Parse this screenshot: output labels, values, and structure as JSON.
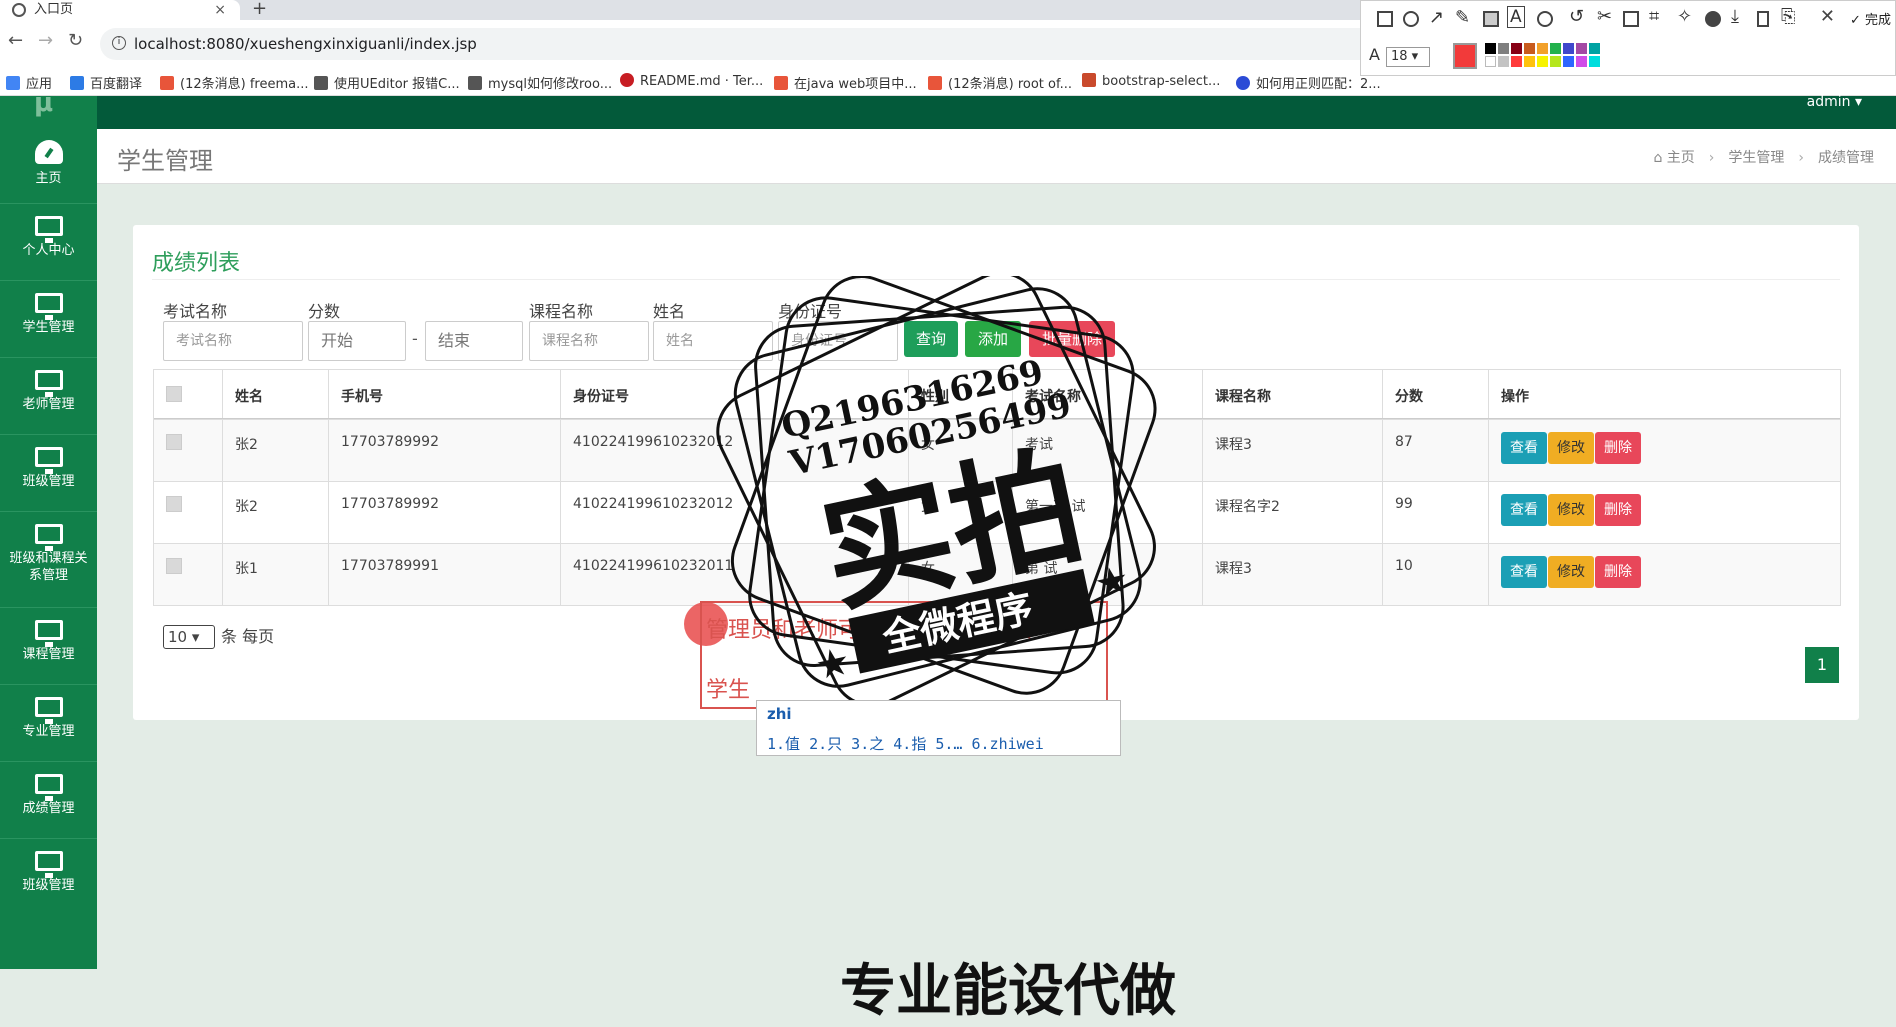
{
  "browser": {
    "tab_title": "入口页",
    "new_tab": "+",
    "close_tab": "×",
    "url": "localhost:8080/xueshengxinxiguanli/index.jsp",
    "bookmarks": [
      "应用",
      "百度翻译",
      "(12条消息) freema...",
      "使用UEditor 报错C...",
      "mysql如何修改roo...",
      "README.md · Ter...",
      "在java web项目中...",
      "(12条消息) root of...",
      "bootstrap-select...",
      "如何用正则匹配：2..."
    ]
  },
  "app": {
    "admin_label": "admin ▾",
    "sidebar": [
      "主页",
      "个人中心",
      "学生管理",
      "老师管理",
      "班级管理",
      "班级和课程关系管理",
      "课程管理",
      "专业管理",
      "成绩管理",
      "班级管理"
    ],
    "page_title": "学生管理",
    "breadcrumb": [
      "主页",
      "学生管理",
      "成绩管理"
    ]
  },
  "panel": {
    "title": "成绩列表",
    "filters": {
      "exam_label": "考试名称",
      "exam_placeholder": "考试名称",
      "score_label": "分数",
      "score_start": "开始",
      "score_end": "结束",
      "score_dash": "-",
      "course_label": "课程名称",
      "course_placeholder": "课程名称",
      "name_label": "姓名",
      "name_placeholder": "姓名",
      "id_label": "身份证号",
      "id_placeholder": "身份证号"
    },
    "buttons": {
      "query": "查询",
      "add": "添加",
      "batch_delete": "批量删除"
    },
    "columns": [
      "姓名",
      "手机号",
      "身份证号",
      "性别",
      "考试名称",
      "课程名称",
      "分数",
      "操作"
    ],
    "rows": [
      {
        "name": "张2",
        "phone": "17703789992",
        "idno": "410224199610232012",
        "gender": "女",
        "exam": "考试",
        "course": "课程3",
        "score": "87"
      },
      {
        "name": "张2",
        "phone": "17703789992",
        "idno": "410224199610232012",
        "gender": "女",
        "exam": "第一次 试",
        "course": "课程名字2",
        "score": "99"
      },
      {
        "name": "张1",
        "phone": "17703789991",
        "idno": "410224199610232011",
        "gender": "女",
        "exam": "第 试",
        "course": "课程3",
        "score": "10"
      }
    ],
    "row_actions": {
      "view": "查看",
      "edit": "修改",
      "delete": "删除"
    },
    "page_size": "10",
    "page_size_suffix": "条 每页",
    "current_page": "1"
  },
  "overlay": {
    "stamp_line1": "Q2196316269",
    "stamp_line2": "V17060256499",
    "stamp_big": "实拍",
    "stamp_banner": "全微程序",
    "note_line1": "管理员和老师可",
    "note_line1_tail": "页",
    "note_line2": "学生",
    "ime_code": "zhi",
    "ime_candidates": "1.值  2.只  3.之  4.指  5.…  6.zhiwei",
    "bottom_text": "专业能设代做"
  },
  "annotation_toolbar": {
    "font_size": "18",
    "font_size_label": "A",
    "done": "✓ 完成",
    "close": "✕",
    "current_color": "#f23a3a",
    "palette": [
      "#000000",
      "#7f7f7f",
      "#880015",
      "#c85b1e",
      "#f2a12b",
      "#22b14c",
      "#3f48cc",
      "#a349a4",
      "#00a2a2",
      "#ffffff",
      "#c3c3c3",
      "#ff3b3b",
      "#ffc20e",
      "#f7f300",
      "#b5e61d",
      "#2e66ff",
      "#d04de8",
      "#00dddd"
    ]
  }
}
